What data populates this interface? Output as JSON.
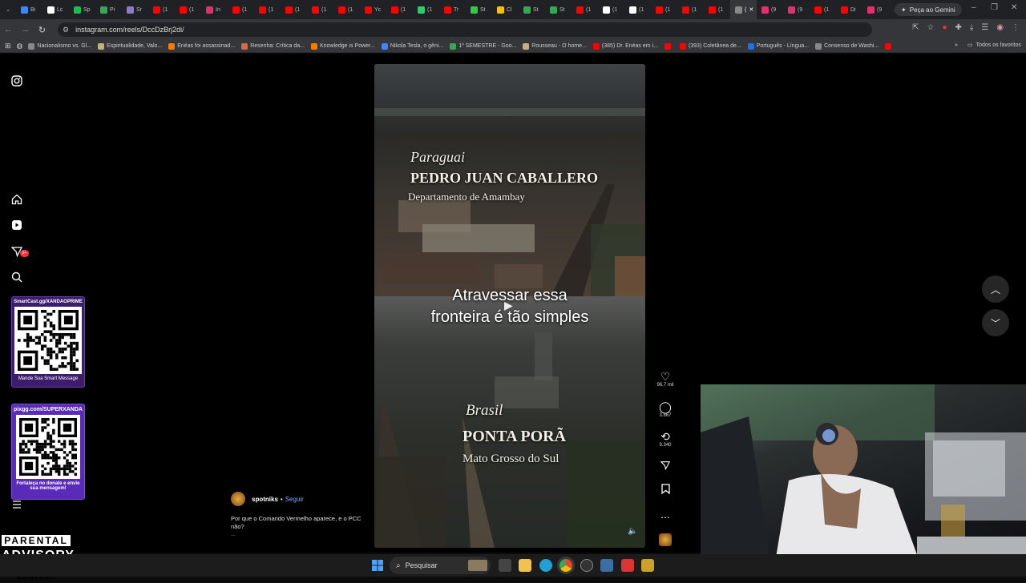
{
  "browser": {
    "tabs": [
      {
        "label": "Bi",
        "color": "#4285f4"
      },
      {
        "label": "Lc",
        "color": "#ffffff"
      },
      {
        "label": "Sp",
        "color": "#1db954"
      },
      {
        "label": "Pi",
        "color": "#34a853"
      },
      {
        "label": "Sr",
        "color": "#8e7cc3"
      },
      {
        "label": "(1",
        "color": "#ff0000"
      },
      {
        "label": "(1",
        "color": "#ff0000"
      },
      {
        "label": "In",
        "color": "#e1306c"
      },
      {
        "label": "(1",
        "color": "#ff0000"
      },
      {
        "label": "(1",
        "color": "#ff0000"
      },
      {
        "label": "(1",
        "color": "#ff0000"
      },
      {
        "label": "(1",
        "color": "#ff0000"
      },
      {
        "label": "(1",
        "color": "#ff0000"
      },
      {
        "label": "Yc",
        "color": "#ff0000"
      },
      {
        "label": "(1",
        "color": "#ff0000"
      },
      {
        "label": "(1",
        "color": "#25d366"
      },
      {
        "label": "Tr",
        "color": "#ff0000"
      },
      {
        "label": "St",
        "color": "#2ecc40"
      },
      {
        "label": "Cl",
        "color": "#f4c20d"
      },
      {
        "label": "St",
        "color": "#34a853"
      },
      {
        "label": "St",
        "color": "#34a853"
      },
      {
        "label": "(1",
        "color": "#ff0000"
      },
      {
        "label": "(1",
        "color": "#ffffff"
      },
      {
        "label": "(1",
        "color": "#ffffff"
      },
      {
        "label": "(1",
        "color": "#ff0000"
      },
      {
        "label": "(1",
        "color": "#ff0000"
      },
      {
        "label": "(1",
        "color": "#ff0000"
      },
      {
        "label": "(",
        "color": "#888888",
        "active": true
      },
      {
        "label": "(9",
        "color": "#e1306c"
      },
      {
        "label": "(9",
        "color": "#e1306c"
      },
      {
        "label": "(1",
        "color": "#ff0000"
      },
      {
        "label": "Di",
        "color": "#ff0000"
      },
      {
        "label": "(9",
        "color": "#e1306c"
      }
    ],
    "new_tab": "+",
    "gemini_label": "Peça ao Gemini",
    "url": "instagram.com/reels/DccDzBrj2di/",
    "bookmarks": [
      {
        "label": "Nacionalismo vs. Gl...",
        "color": "#888888"
      },
      {
        "label": "Espiritualidade, Valo...",
        "color": "#c2b280"
      },
      {
        "label": "Enéas foi assassinad...",
        "color": "#ff7a00"
      },
      {
        "label": "Resenha: Crítica da...",
        "color": "#d36b4a"
      },
      {
        "label": "Knowledge is Power...",
        "color": "#ff7a00"
      },
      {
        "label": "Nikola Tesla, o gêni...",
        "color": "#4285f4"
      },
      {
        "label": "1º SEMESTRE - Goo...",
        "color": "#34a853"
      },
      {
        "label": "Rousseau - O home...",
        "color": "#c2b280"
      },
      {
        "label": "(385) Dr. Enéas em i...",
        "color": "#ff0000"
      },
      {
        "label": "",
        "color": "#ff0000"
      },
      {
        "label": "(393) Coletânea de...",
        "color": "#ff0000"
      },
      {
        "label": "Português - Língua...",
        "color": "#1a73e8"
      },
      {
        "label": "Consenso de Washi...",
        "color": "#888888"
      },
      {
        "label": "",
        "color": "#ff0000"
      }
    ],
    "all_bookmarks": "Todos os favoritos"
  },
  "sidebar": {
    "icons": [
      "instagram-icon",
      "home-icon",
      "reels-icon",
      "messages-icon",
      "search-icon",
      "menu-icon"
    ],
    "notification_count": "9+"
  },
  "widgets": {
    "qr1_title": "SmartCast.gg/XANDAOPRIME",
    "qr1_caption": "Mande Sua Smart Message",
    "qr2_title": "pixgg.com/SUPERXANDA",
    "qr2_caption": "Fortaleça no donate e envie sua mensagem!"
  },
  "reel": {
    "top_country": "Paraguai",
    "top_city": "PEDRO JUAN CABALLERO",
    "top_region": "Departamento de Amambay",
    "overlay_line1": "Atravessar essa",
    "overlay_line2": "fronteira é tão simples",
    "bottom_country": "Brasil",
    "bottom_city": "PONTA PORÃ",
    "bottom_region": "Mato Grosso do Sul",
    "author": "spotniks",
    "follow": "Seguir",
    "separator": "•",
    "caption": "Por que o Comando Vermelho aparece, e o PCC não?",
    "more": "..."
  },
  "actions": {
    "likes": "96,7 mil",
    "comments": "3.867",
    "reposts": "9.340",
    "more": "..."
  },
  "advisory": {
    "line1": "PARENTAL",
    "line2": "ADVISORY",
    "line3": "EXPLICIT CONTENT"
  },
  "taskbar": {
    "search_placeholder": "Pesquisar"
  }
}
